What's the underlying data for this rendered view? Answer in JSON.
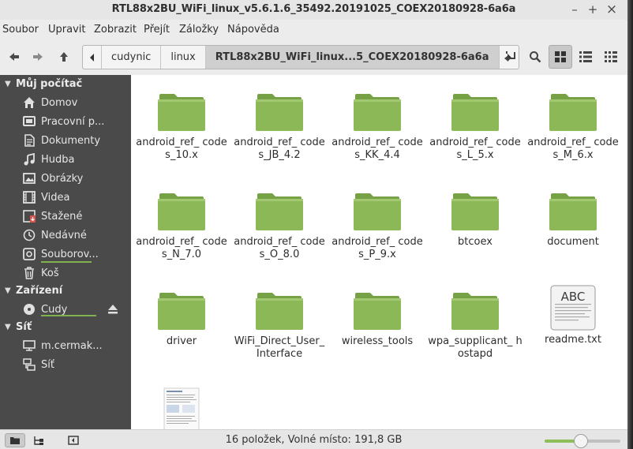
{
  "window": {
    "title": "RTL88x2BU_WiFi_linux_v5.6.1.6_35492.20191025_COEX20180928-6a6a",
    "minimize": "–",
    "maximize": "+",
    "close": "×"
  },
  "menu": [
    "Soubor",
    "Upravit",
    "Zobrazit",
    "Přejít",
    "Záložky",
    "Nápověda"
  ],
  "breadcrumbs": {
    "items": [
      "cudynic",
      "linux",
      "RTL88x2BU_WiFi_linux...5_COEX20180928-6a6a"
    ]
  },
  "sidebar": {
    "computer": {
      "title": "Můj počítač",
      "items": [
        {
          "label": "Domov",
          "icon": "home-icon"
        },
        {
          "label": "Pracovní p...",
          "icon": "desktop-icon"
        },
        {
          "label": "Dokumenty",
          "icon": "documents-icon"
        },
        {
          "label": "Hudba",
          "icon": "music-icon"
        },
        {
          "label": "Obrázky",
          "icon": "pictures-icon"
        },
        {
          "label": "Videa",
          "icon": "videos-icon"
        },
        {
          "label": "Stažené",
          "icon": "downloads-icon"
        },
        {
          "label": "Nedávné",
          "icon": "recent-icon"
        },
        {
          "label": "Souborov...",
          "icon": "filesystem-icon",
          "usage": 0.92
        },
        {
          "label": "Koš",
          "icon": "trash-icon"
        }
      ]
    },
    "devices": {
      "title": "Zařízení",
      "items": [
        {
          "label": "Cudy",
          "icon": "disc-icon",
          "usage": 1.0
        }
      ]
    },
    "network": {
      "title": "Síť",
      "items": [
        {
          "label": "m.cermak...",
          "icon": "network-share-icon"
        },
        {
          "label": "Síť",
          "icon": "network-icon"
        }
      ]
    }
  },
  "files": [
    {
      "name": "android_ref_ codes_10.x",
      "type": "folder"
    },
    {
      "name": "android_ref_ codes_JB_4.2",
      "type": "folder"
    },
    {
      "name": "android_ref_ codes_KK_4.4",
      "type": "folder"
    },
    {
      "name": "android_ref_ codes_L_5.x",
      "type": "folder"
    },
    {
      "name": "android_ref_ codes_M_6.x",
      "type": "folder"
    },
    {
      "name": "android_ref_ codes_N_7.0",
      "type": "folder"
    },
    {
      "name": "android_ref_ codes_O_8.0",
      "type": "folder"
    },
    {
      "name": "android_ref_ codes_P_9.x",
      "type": "folder"
    },
    {
      "name": "btcoex",
      "type": "folder"
    },
    {
      "name": "document",
      "type": "folder"
    },
    {
      "name": "driver",
      "type": "folder"
    },
    {
      "name": "WiFi_Direct_User_ Interface",
      "type": "folder"
    },
    {
      "name": "wireless_tools",
      "type": "folder"
    },
    {
      "name": "wpa_supplicant_ hostapd",
      "type": "folder"
    },
    {
      "name": "readme.txt",
      "type": "text",
      "badge": "ABC"
    },
    {
      "name": "",
      "type": "document-thumbnail"
    }
  ],
  "status": {
    "text": "16 položek, Volné místo: 191,8 GB",
    "zoom": 0.48
  },
  "colors": {
    "folder": "#8cb857",
    "folder_dark": "#76a145",
    "sidebar_bg": "#4a4a4a",
    "accent": "#8cbf5a"
  }
}
